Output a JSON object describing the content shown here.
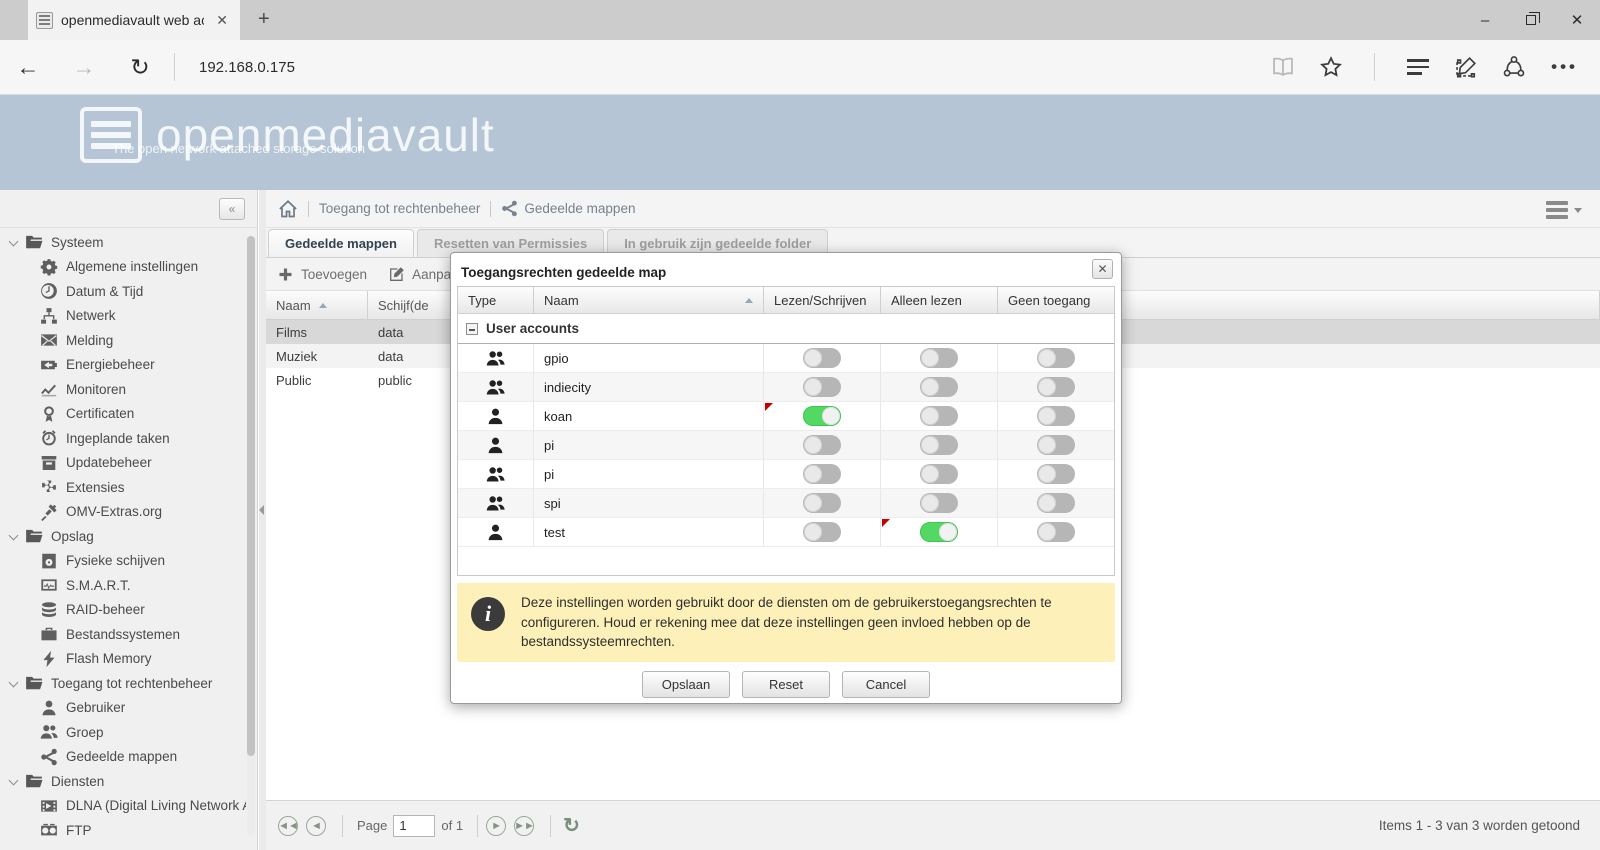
{
  "browser": {
    "tab_title": "openmediavault web ac",
    "url": "192.168.0.175",
    "window_controls": {
      "minimize": "minimize",
      "restore": "restore",
      "close": "close"
    }
  },
  "header": {
    "logo_text": "openmediavault",
    "logo_subtitle": "The open network attached storage solution"
  },
  "sidebar": {
    "collapse_glyph": "«",
    "sections": [
      {
        "label": "Systeem",
        "icon": "folder",
        "children": [
          {
            "label": "Algemene instellingen",
            "icon": "gears"
          },
          {
            "label": "Datum & Tijd",
            "icon": "clock"
          },
          {
            "label": "Netwerk",
            "icon": "network"
          },
          {
            "label": "Melding",
            "icon": "mail"
          },
          {
            "label": "Energiebeheer",
            "icon": "power"
          },
          {
            "label": "Monitoren",
            "icon": "chart"
          },
          {
            "label": "Certificaten",
            "icon": "cert"
          },
          {
            "label": "Ingeplande taken",
            "icon": "alarm"
          },
          {
            "label": "Updatebeheer",
            "icon": "package"
          },
          {
            "label": "Extensies",
            "icon": "puzzle"
          },
          {
            "label": "OMV-Extras.org",
            "icon": "plug"
          }
        ]
      },
      {
        "label": "Opslag",
        "icon": "folder",
        "children": [
          {
            "label": "Fysieke schijven",
            "icon": "disk"
          },
          {
            "label": "S.M.A.R.T.",
            "icon": "smart"
          },
          {
            "label": "RAID-beheer",
            "icon": "raid"
          },
          {
            "label": "Bestandssystemen",
            "icon": "fs"
          },
          {
            "label": "Flash Memory",
            "icon": "flash"
          }
        ]
      },
      {
        "label": "Toegang tot rechtenbeheer",
        "icon": "folder",
        "children": [
          {
            "label": "Gebruiker",
            "icon": "user"
          },
          {
            "label": "Groep",
            "icon": "group"
          },
          {
            "label": "Gedeelde mappen",
            "icon": "share"
          }
        ]
      },
      {
        "label": "Diensten",
        "icon": "folder",
        "children": [
          {
            "label": "DLNA (Digital Living Network All",
            "icon": "film"
          },
          {
            "label": "FTP",
            "icon": "ftp"
          }
        ]
      }
    ]
  },
  "breadcrumb": {
    "section": "Toegang tot rechtenbeheer",
    "page": "Gedeelde mappen"
  },
  "tabs": [
    {
      "label": "Gedeelde mappen",
      "state": "active"
    },
    {
      "label": "Resetten van Permissies",
      "state": "disabled"
    },
    {
      "label": "In gebruik zijn gedeelde folder",
      "state": "disabled"
    }
  ],
  "toolbar": {
    "add_label": "Toevoegen",
    "edit_label": "Aanpass"
  },
  "grid": {
    "columns": [
      "Naam",
      "Schijf(de"
    ],
    "rows": [
      {
        "naam": "Films",
        "schijf": "data",
        "selected": true
      },
      {
        "naam": "Muziek",
        "schijf": "data",
        "selected": false
      },
      {
        "naam": "Public",
        "schijf": "public",
        "selected": false
      }
    ]
  },
  "pagination": {
    "page_label": "Page",
    "input_value": "1",
    "of_label": "of 1",
    "status": "Items 1 - 3 van 3 worden getoond"
  },
  "dialog": {
    "title": "Toegangsrechten gedeelde map",
    "close_glyph": "✕",
    "columns": [
      "Type",
      "Naam",
      "Lezen/Schrijven",
      "Alleen lezen",
      "Geen toegang"
    ],
    "group_label": "User accounts",
    "rows": [
      {
        "type": "group",
        "name": "gpio",
        "rw": false,
        "ro": false,
        "deny": false,
        "flag": null
      },
      {
        "type": "group",
        "name": "indiecity",
        "rw": false,
        "ro": false,
        "deny": false,
        "flag": null
      },
      {
        "type": "user",
        "name": "koan",
        "rw": true,
        "ro": false,
        "deny": false,
        "flag": "rw"
      },
      {
        "type": "user",
        "name": "pi",
        "rw": false,
        "ro": false,
        "deny": false,
        "flag": null
      },
      {
        "type": "group",
        "name": "pi",
        "rw": false,
        "ro": false,
        "deny": false,
        "flag": null
      },
      {
        "type": "group",
        "name": "spi",
        "rw": false,
        "ro": false,
        "deny": false,
        "flag": null
      },
      {
        "type": "user",
        "name": "test",
        "rw": false,
        "ro": true,
        "deny": false,
        "flag": "ro"
      }
    ],
    "info_text": "Deze instellingen worden gebruikt door de diensten om de gebruikerstoegangsrechten te configureren. Houd er rekening mee dat deze instellingen geen invloed hebben op de bestandssysteemrechten.",
    "buttons": {
      "save": "Opslaan",
      "reset": "Reset",
      "cancel": "Cancel"
    }
  },
  "colors": {
    "toggle_on": "#53d863",
    "toggle_off": "#b6b6b6",
    "dirty_flag": "#c40000",
    "header_band": "#b5c5d5",
    "info_bg": "#fdf0b8"
  }
}
